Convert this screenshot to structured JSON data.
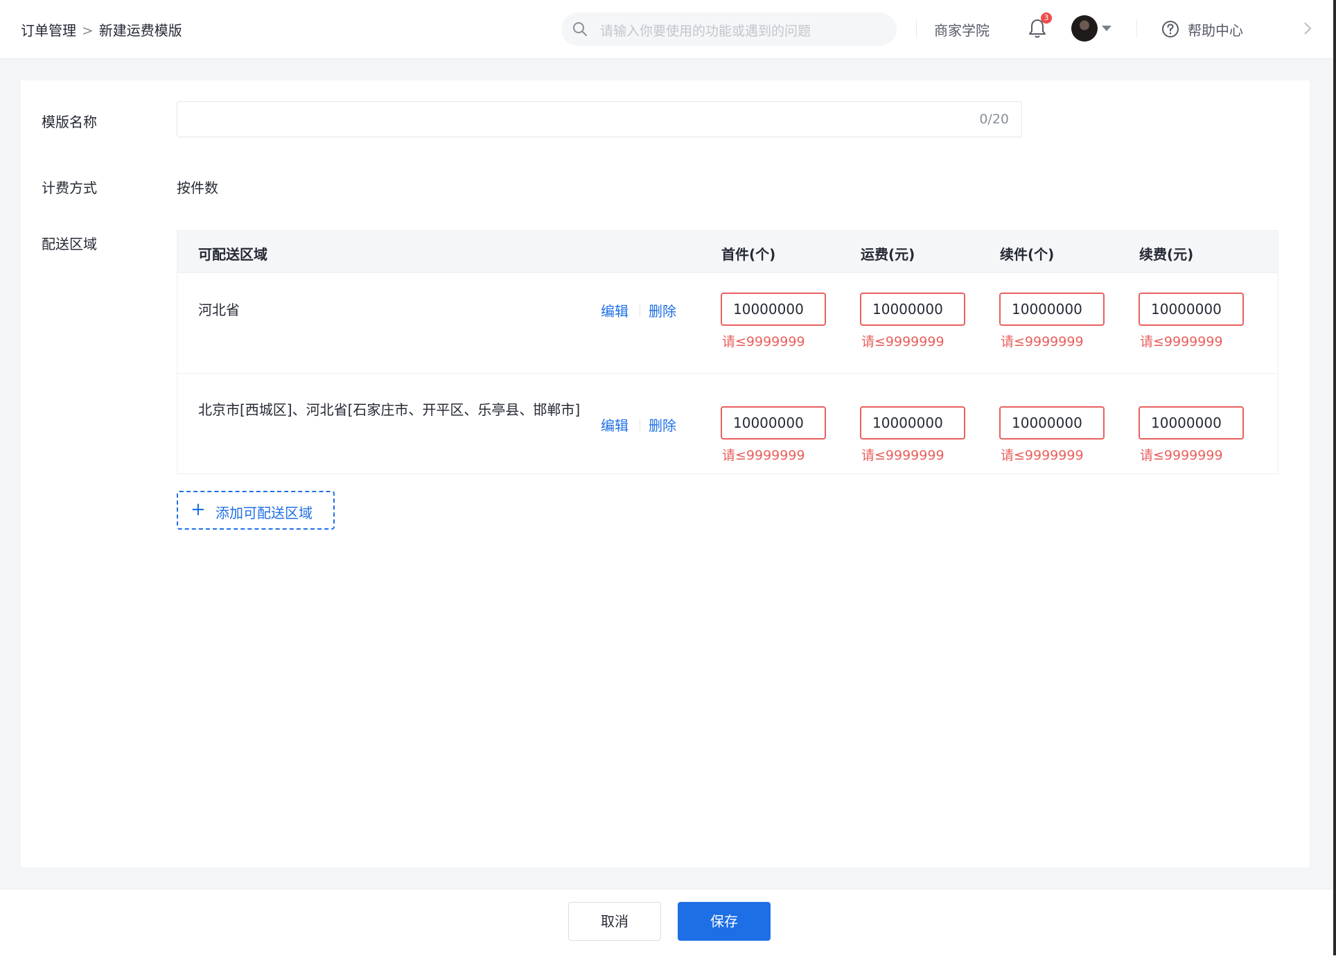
{
  "header": {
    "breadcrumb": [
      "订单管理",
      ">",
      "新建运费模版"
    ],
    "search_placeholder": "请输入你要使用的功能或遇到的问题",
    "academy_link": "商家学院",
    "notification_count": "3",
    "help_link": "帮助中心"
  },
  "form": {
    "template_name_label": "模版名称",
    "template_name_value": "",
    "template_name_counter": "0/20",
    "billing_label": "计费方式",
    "billing_value": "按件数",
    "delivery_label": "配送区域"
  },
  "table": {
    "headers": [
      "可配送区域",
      "首件(个)",
      "运费(元)",
      "续件(个)",
      "续费(元)"
    ],
    "rows": [
      {
        "region": "河北省",
        "edit": "编辑",
        "delete": "删除",
        "values": [
          "10000000",
          "10000000",
          "10000000",
          "10000000"
        ],
        "errors": [
          "请≤9999999",
          "请≤9999999",
          "请≤9999999",
          "请≤9999999"
        ]
      },
      {
        "region": "北京市[西城区]、河北省[石家庄市、开平区、乐亭县、邯郸市]",
        "edit": "编辑",
        "delete": "删除",
        "values": [
          "10000000",
          "10000000",
          "10000000",
          "10000000"
        ],
        "errors": [
          "请≤9999999",
          "请≤9999999",
          "请≤9999999",
          "请≤9999999"
        ]
      }
    ]
  },
  "add_region_button": {
    "icon": "+",
    "label": "添加可配送区域"
  },
  "footer": {
    "cancel": "取消",
    "save": "保存"
  },
  "colors": {
    "primary": "#1e6fe6",
    "error": "#e8605e"
  }
}
